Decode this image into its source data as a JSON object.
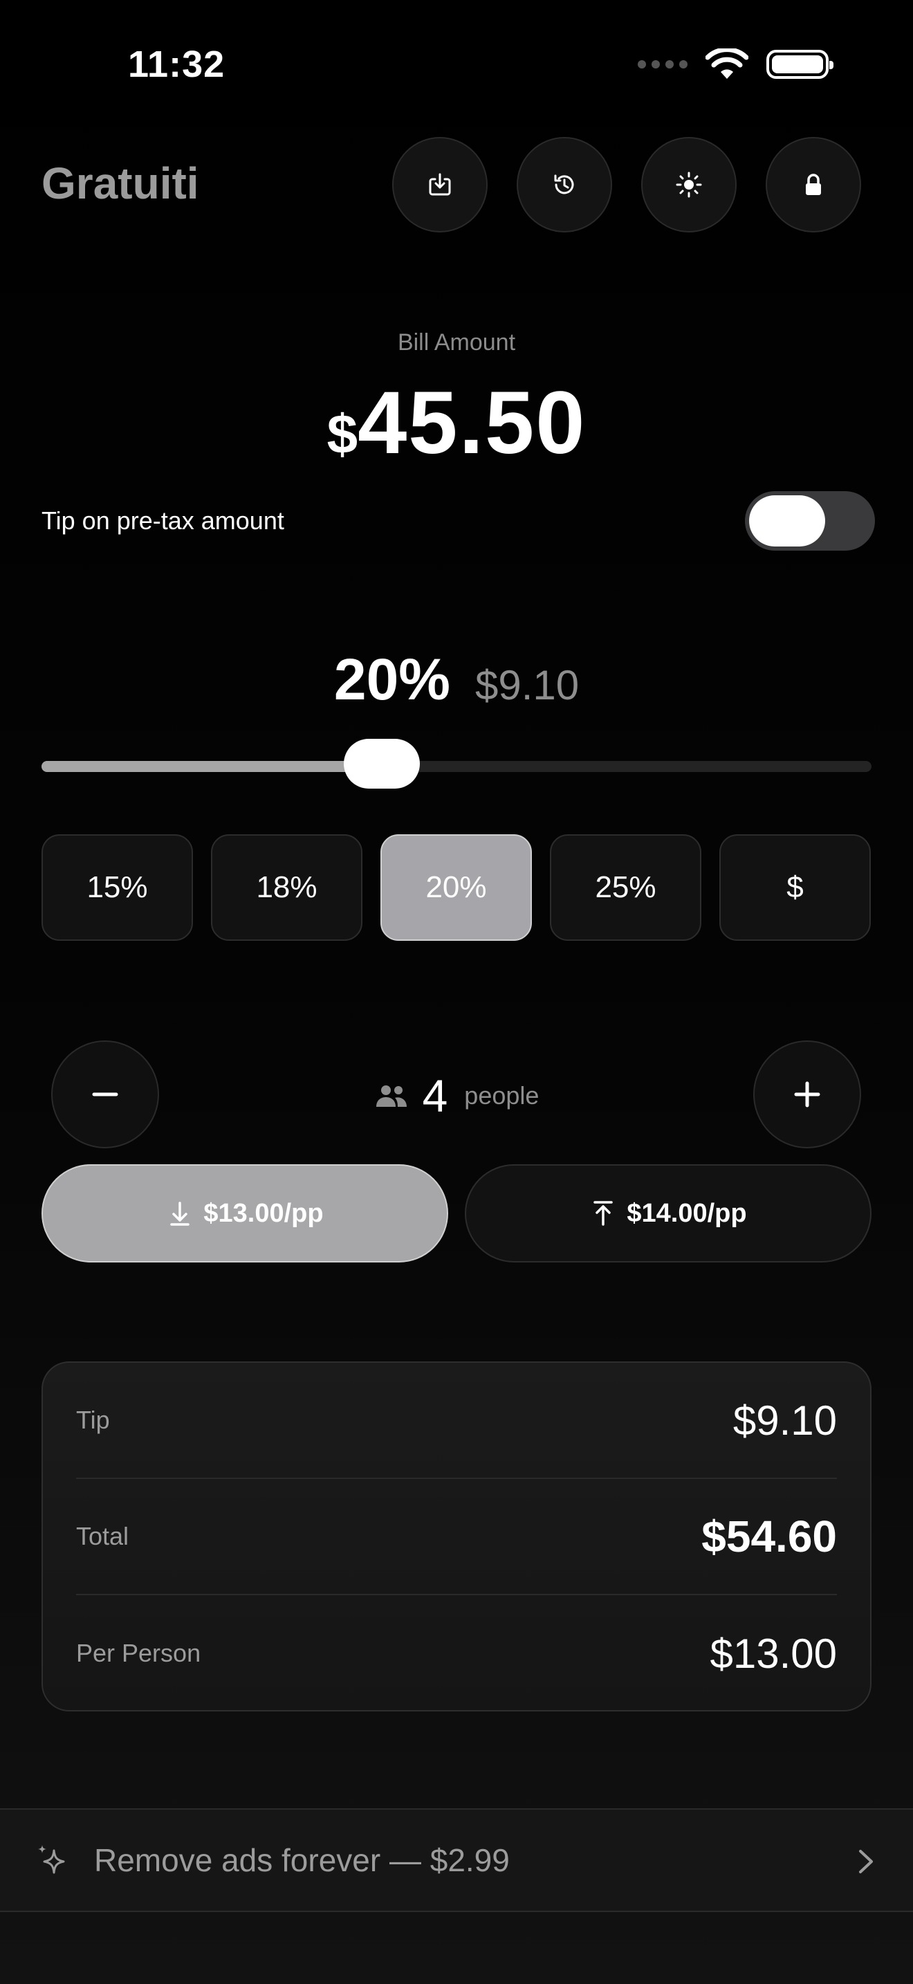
{
  "status": {
    "time": "11:32"
  },
  "header": {
    "title": "Gratuiti",
    "buttons": [
      "download-icon",
      "history-icon",
      "brightness-icon",
      "lock-icon"
    ]
  },
  "bill": {
    "label": "Bill Amount",
    "currency": "$",
    "amount": "45.50"
  },
  "pretax": {
    "label": "Tip on pre-tax amount",
    "enabled": false
  },
  "tip": {
    "percent_text": "20%",
    "amount_text": "$9.10",
    "slider_fraction": 0.41
  },
  "presets": [
    {
      "label": "15%",
      "active": false
    },
    {
      "label": "18%",
      "active": false
    },
    {
      "label": "20%",
      "active": true
    },
    {
      "label": "25%",
      "active": false
    },
    {
      "label": "$",
      "active": false
    }
  ],
  "people": {
    "count": "4",
    "label": "people"
  },
  "split": {
    "round_down": "$13.00/pp",
    "round_up": "$14.00/pp"
  },
  "summary": {
    "tip_label": "Tip",
    "tip_value": "$9.10",
    "total_label": "Total",
    "total_value": "$54.60",
    "per_person_label": "Per Person",
    "per_person_value": "$13.00"
  },
  "ads": {
    "label": "Remove ads forever — $2.99"
  },
  "colors": {
    "accent": "#a6a6aa",
    "background": "#000000",
    "card": "#1b1b1b"
  }
}
